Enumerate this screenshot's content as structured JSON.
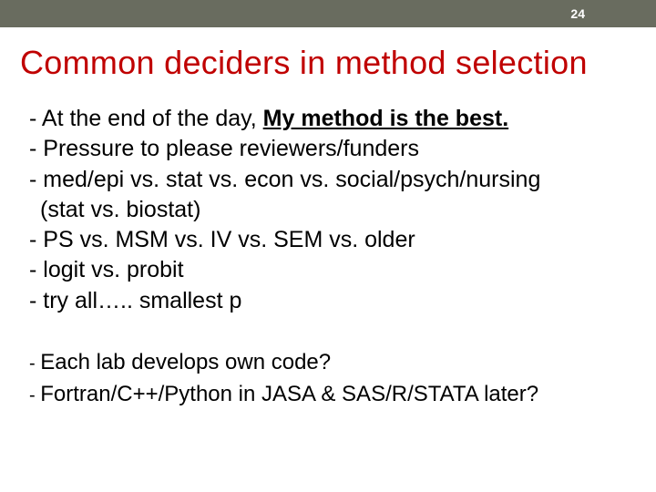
{
  "header": {
    "page_number": "24"
  },
  "title": "Common deciders in method selection",
  "main_bullets": {
    "item1_prefix": "At the end of the day, ",
    "item1_emphasis": "My method is the best.",
    "item2": "Pressure to please reviewers/funders",
    "item3": "med/epi vs. stat vs. econ vs. social/psych/nursing",
    "item3_cont": "(stat vs. biostat)",
    "item4": "PS vs. MSM vs. IV vs. SEM vs. older",
    "item5": "logit vs. probit",
    "item6": "try all….. smallest p"
  },
  "secondary_bullets": {
    "item1": "Each lab develops own code?",
    "item2": "Fortran/C++/Python in JASA & SAS/R/STATA later?"
  }
}
